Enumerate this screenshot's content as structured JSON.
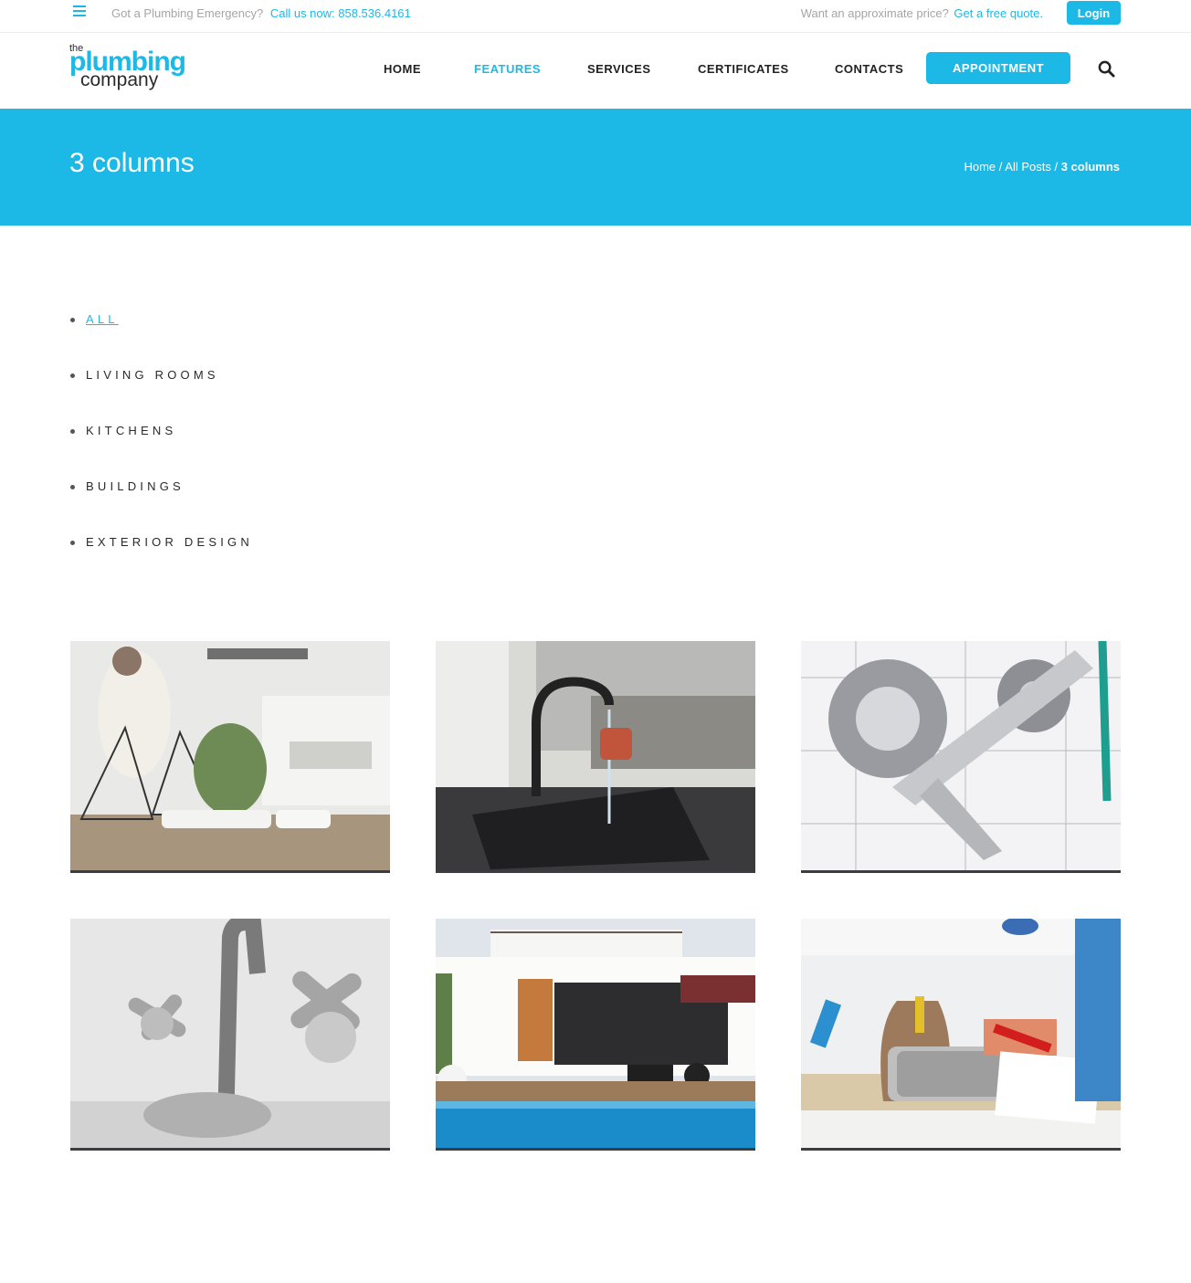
{
  "topbar": {
    "emergency_text": "Got a Plumbing Emergency?",
    "phone_text": "Call us now: 858.536.4161",
    "quote_text": "Want an approximate price?",
    "quote_link": "Get a free quote.",
    "login_label": "Login"
  },
  "logo": {
    "the": "the",
    "plumbing": "plumbing",
    "company": "company"
  },
  "nav": {
    "items": [
      {
        "label": "HOME",
        "active": false
      },
      {
        "label": "FEATURES",
        "active": true
      },
      {
        "label": "SERVICES",
        "active": false
      },
      {
        "label": "CERTIFICATES",
        "active": false
      },
      {
        "label": "CONTACTS",
        "active": false
      }
    ],
    "appointment_label": "APPOINTMENT"
  },
  "banner": {
    "title": "3 columns",
    "breadcrumb": {
      "home": "Home",
      "sep1": " / ",
      "all_posts": "All Posts",
      "sep2": " / ",
      "current": "3 columns"
    }
  },
  "filters": [
    {
      "label": "ALL",
      "active": true
    },
    {
      "label": "LIVING ROOMS",
      "active": false
    },
    {
      "label": "KITCHENS",
      "active": false
    },
    {
      "label": "BUILDINGS",
      "active": false
    },
    {
      "label": "EXTERIOR DESIGN",
      "active": false
    }
  ],
  "gallery": [
    {
      "subject": "kitchen with terrarium and plant"
    },
    {
      "subject": "black kitchen sink with running faucet"
    },
    {
      "subject": "caliper and bearings on blueprint"
    },
    {
      "subject": "chrome faucet close-up"
    },
    {
      "subject": "modern house with pool"
    },
    {
      "subject": "plumber with tool bag at sink"
    }
  ],
  "colors": {
    "accent": "#1cb9e7",
    "text": "#222222",
    "muted": "#a5a5a5",
    "tile_border": "#3b3d44"
  }
}
